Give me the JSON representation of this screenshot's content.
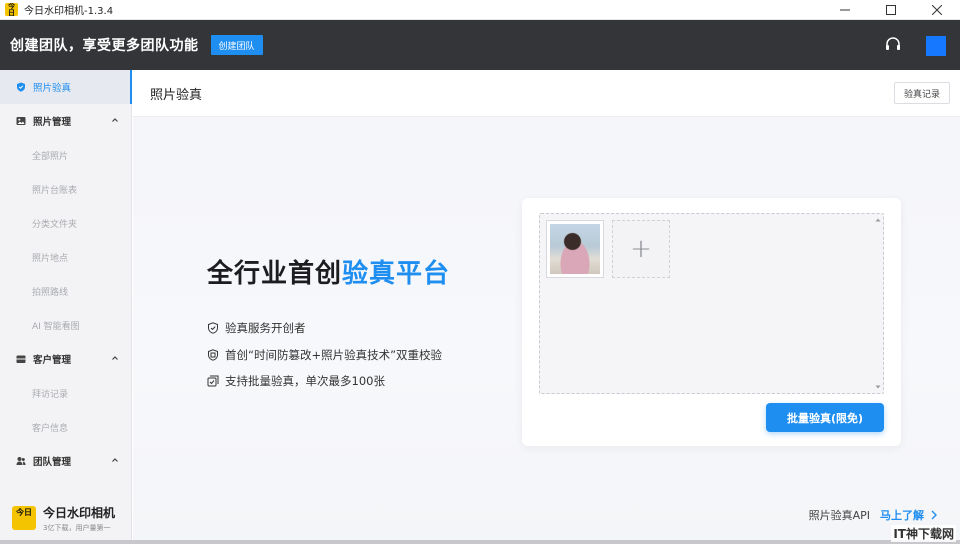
{
  "window": {
    "title": "今日水印相机-1.3.4",
    "logo_text": "今日"
  },
  "header": {
    "promo": "创建团队，享受更多团队功能",
    "create_team_label": "创建团队"
  },
  "sidebar": {
    "items": [
      {
        "label": "照片验真",
        "icon": "shield-icon",
        "active": true
      },
      {
        "label": "照片管理",
        "icon": "image-icon",
        "group": true
      },
      {
        "label": "全部照片"
      },
      {
        "label": "照片台账表"
      },
      {
        "label": "分类文件夹"
      },
      {
        "label": "照片地点"
      },
      {
        "label": "拍照路线"
      },
      {
        "label": "AI 智能看图"
      },
      {
        "label": "客户管理",
        "icon": "inbox-icon",
        "group": true
      },
      {
        "label": "拜访记录"
      },
      {
        "label": "客户信息"
      },
      {
        "label": "团队管理",
        "icon": "team-icon",
        "group": true
      }
    ],
    "brand": {
      "logo_text": "今日",
      "name": "今日水印相机",
      "tagline": "3亿下载，用户量第一"
    }
  },
  "main": {
    "title": "照片验真",
    "records_label": "验真记录",
    "hero": {
      "title_prefix": "全行业首创",
      "title_accent": "验真平台"
    },
    "features": [
      {
        "icon": "shield-check-icon",
        "text": "验真服务开创者"
      },
      {
        "icon": "badge-icon",
        "text": "首创“时间防篡改+照片验真技术”双重校验"
      },
      {
        "icon": "batch-icon",
        "text": "支持批量验真，单次最多100张"
      }
    ],
    "upload": {
      "add_symbol": "+",
      "verify_label": "批量验真(限免)"
    },
    "api": {
      "label": "照片验真API",
      "cta": "马上了解"
    }
  },
  "watermark": "IT神下载网",
  "colors": {
    "accent": "#1f8ef1",
    "header_bg": "#333538",
    "sidebar_bg": "#f3f3f5",
    "brand_yellow": "#f5c400"
  }
}
